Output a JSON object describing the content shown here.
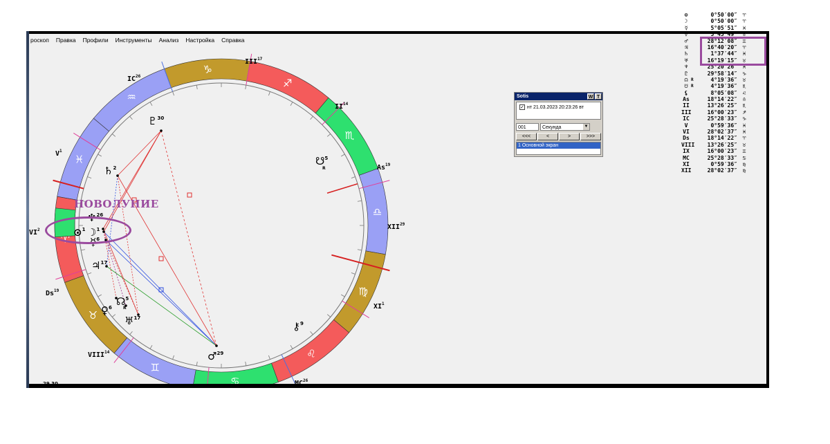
{
  "menu": [
    "роскоп",
    "Правка",
    "Профили",
    "Инструменты",
    "Анализ",
    "Настройка",
    "Справка"
  ],
  "annotation": {
    "label": "НОВОЛУНИЕ"
  },
  "wheel": {
    "signs": [
      {
        "glyph": "♓",
        "color": "#9aa0f5"
      },
      {
        "glyph": "♒",
        "color": "#9aa0f5"
      },
      {
        "glyph": "♑",
        "color": "#c29a2c"
      },
      {
        "glyph": "♐",
        "color": "#f45b5b"
      },
      {
        "glyph": "♏",
        "color": "#2ee06f"
      },
      {
        "glyph": "♎",
        "color": "#9aa0f5"
      },
      {
        "glyph": "♍",
        "color": "#c29a2c"
      },
      {
        "glyph": "♌",
        "color": "#f45b5b"
      },
      {
        "glyph": "♋",
        "color": "#2ee06f"
      },
      {
        "glyph": "♊",
        "color": "#9aa0f5"
      },
      {
        "glyph": "♉",
        "color": "#c29a2c"
      },
      {
        "glyph": "♈",
        "color": "#f45b5b"
      }
    ],
    "extra_sign": {
      "glyph": "♓",
      "color": "#2ee06f"
    },
    "cusps": [
      {
        "label": "III",
        "deg": "17"
      },
      {
        "label": "IC",
        "deg": "26"
      },
      {
        "label": "II",
        "deg": "14"
      },
      {
        "label": "V",
        "deg": "1"
      },
      {
        "label": "As",
        "deg": "19"
      },
      {
        "label": "VI",
        "deg": "2"
      },
      {
        "label": "XII",
        "deg": "29"
      },
      {
        "label": "Ds",
        "deg": "19"
      },
      {
        "label": "XI",
        "deg": "1"
      },
      {
        "label": "VIII",
        "deg": "14"
      },
      {
        "label": "MC",
        "deg": "26"
      }
    ],
    "planets": [
      {
        "glyph": "♇",
        "deg": "30"
      },
      {
        "glyph": "☋",
        "deg": "5"
      },
      {
        "glyph": "♄",
        "deg": "2"
      },
      {
        "glyph": "♆",
        "deg": "26"
      },
      {
        "glyph": "⊙",
        "deg": "1"
      },
      {
        "glyph": "☽",
        "deg": "1"
      },
      {
        "glyph": "♃",
        "deg": "17"
      },
      {
        "glyph": "☊",
        "deg": "5"
      },
      {
        "glyph": "♀",
        "deg": "6"
      },
      {
        "glyph": "♅",
        "deg": "17"
      },
      {
        "glyph": "⚷",
        "deg": "9"
      },
      {
        "glyph": "♂",
        "deg": "29"
      },
      {
        "glyph": "☿",
        "deg": "6"
      }
    ],
    "retro_marker": "R",
    "partial_text": "29 30"
  },
  "dialog": {
    "title": "Sotis",
    "btn_w": "W",
    "btn_t": "T",
    "datetime": "нт 21.03.2023 20:23:26 вт",
    "step": "001",
    "unit": "Секунда",
    "nav": [
      "<<<",
      "<",
      ">",
      ">>>"
    ],
    "list_item": "1 Основной экран"
  },
  "positions": [
    {
      "sym": "⊙",
      "r": "",
      "deg": "0°50′00″",
      "sign": "♈"
    },
    {
      "sym": "☽",
      "r": "",
      "deg": "0°50′00″",
      "sign": "♈"
    },
    {
      "sym": "☿",
      "r": "",
      "deg": "5°05′51″",
      "sign": "♓"
    },
    {
      "sym": "♀",
      "r": "",
      "deg": "5°45′49″",
      "sign": "♉"
    },
    {
      "sym": "♂",
      "r": "",
      "deg": "28°12′08″",
      "sign": "♊"
    },
    {
      "sym": "♃",
      "r": "",
      "deg": "16°40′20″",
      "sign": "♈"
    },
    {
      "sym": "♄",
      "r": "",
      "deg": "1°37′44″",
      "sign": "♓"
    },
    {
      "sym": "♅",
      "r": "",
      "deg": "16°19′15″",
      "sign": "♉"
    },
    {
      "sym": "♆",
      "r": "",
      "deg": "25°20′26″",
      "sign": "♓"
    },
    {
      "sym": "♇",
      "r": "",
      "deg": "29°58′14″",
      "sign": "♑"
    },
    {
      "sym": "☊",
      "r": "R",
      "deg": "4°19′36″",
      "sign": "♉"
    },
    {
      "sym": "☋",
      "r": "R",
      "deg": "4°19′36″",
      "sign": "♏"
    },
    {
      "sym": "⚸",
      "r": "",
      "deg": "8°05′08″",
      "sign": "♌"
    },
    {
      "sym": "As",
      "r": "",
      "deg": "18°14′22″",
      "sign": "♎"
    },
    {
      "sym": "II",
      "r": "",
      "deg": "13°26′25″",
      "sign": "♏"
    },
    {
      "sym": "III",
      "r": "",
      "deg": "16°00′23″",
      "sign": "♐"
    },
    {
      "sym": "IC",
      "r": "",
      "deg": "25°28′33″",
      "sign": "♑"
    },
    {
      "sym": "V",
      "r": "",
      "deg": "0°59′36″",
      "sign": "♓"
    },
    {
      "sym": "VI",
      "r": "",
      "deg": "28°02′37″",
      "sign": "♓"
    },
    {
      "sym": "Ds",
      "r": "",
      "deg": "18°14′22″",
      "sign": "♈"
    },
    {
      "sym": "VIII",
      "r": "",
      "deg": "13°26′25″",
      "sign": "♉"
    },
    {
      "sym": "IX",
      "r": "",
      "deg": "16°00′23″",
      "sign": "♊"
    },
    {
      "sym": "MC",
      "r": "",
      "deg": "25°28′33″",
      "sign": "♋"
    },
    {
      "sym": "XI",
      "r": "",
      "deg": "0°59′36″",
      "sign": "♍"
    },
    {
      "sym": "XII",
      "r": "",
      "deg": "28°02′37″",
      "sign": "♍"
    }
  ]
}
